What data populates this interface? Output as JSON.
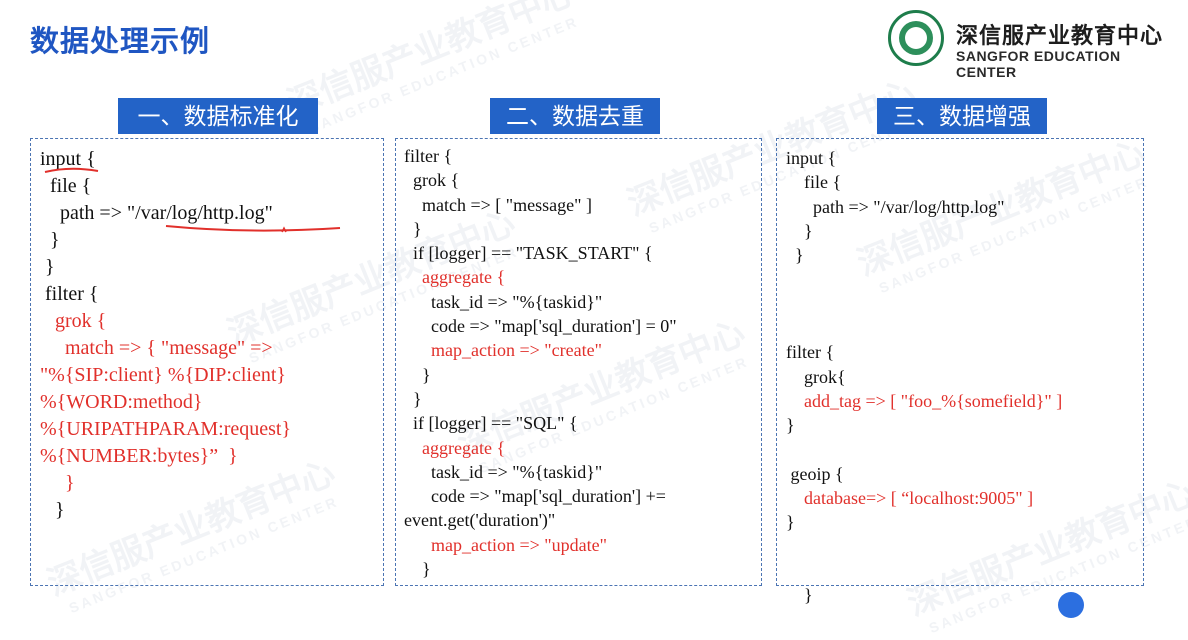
{
  "page": {
    "title": "数据处理示例"
  },
  "logo": {
    "name_cn": "深信服产业教育中心",
    "name_en": "SANGFOR EDUCATION CENTER"
  },
  "watermark": {
    "text_cn": "深信服产业教育中心",
    "text_en": "SANGFOR EDUCATION CENTER"
  },
  "sections": [
    {
      "label": "一、数据标准化",
      "lines": [
        {
          "text": "input {",
          "color": "black"
        },
        {
          "text": "  file {",
          "color": "black"
        },
        {
          "text": "    path => \"/var/log/http.log\"",
          "color": "black"
        },
        {
          "text": "  }",
          "color": "black"
        },
        {
          "text": " }",
          "color": "black"
        },
        {
          "text": " filter {",
          "color": "black"
        },
        {
          "text": "   grok {",
          "color": "red"
        },
        {
          "text": "     match => { \"message\" =>",
          "color": "red"
        },
        {
          "text": "\"%{SIP:client} %{DIP:client}",
          "color": "red"
        },
        {
          "text": "%{WORD:method}",
          "color": "red"
        },
        {
          "text": "%{URIPATHPARAM:request}",
          "color": "red"
        },
        {
          "text": "%{NUMBER:bytes}”  }",
          "color": "red"
        },
        {
          "text": "     }",
          "color": "red"
        },
        {
          "text": "   }",
          "color": "black"
        }
      ]
    },
    {
      "label": "二、数据去重",
      "lines": [
        {
          "text": "filter {",
          "color": "black"
        },
        {
          "text": "  grok {",
          "color": "black"
        },
        {
          "text": "    match => [ \"message\" ]",
          "color": "black"
        },
        {
          "text": "  }",
          "color": "black"
        },
        {
          "text": "  if [logger] == \"TASK_START\" {",
          "color": "black"
        },
        {
          "text": "    aggregate {",
          "color": "red"
        },
        {
          "text": "      task_id => \"%{taskid}\"",
          "color": "black"
        },
        {
          "text": "      code => \"map['sql_duration'] = 0\"",
          "color": "black"
        },
        {
          "text": "      map_action => \"create\"",
          "color": "red"
        },
        {
          "text": "    }",
          "color": "black"
        },
        {
          "text": "  }",
          "color": "black"
        },
        {
          "text": "  if [logger] == \"SQL\" {",
          "color": "black"
        },
        {
          "text": "    aggregate {",
          "color": "red"
        },
        {
          "text": "      task_id => \"%{taskid}\"",
          "color": "black"
        },
        {
          "text": "      code => \"map['sql_duration'] +=",
          "color": "black"
        },
        {
          "text": "event.get('duration')\"",
          "color": "black"
        },
        {
          "text": "      map_action => \"update\"",
          "color": "red"
        },
        {
          "text": "    }",
          "color": "black"
        }
      ]
    },
    {
      "label": "三、数据增强",
      "lines": [
        {
          "text": "input {",
          "color": "black"
        },
        {
          "text": "    file {",
          "color": "black"
        },
        {
          "text": "      path => \"/var/log/http.log\"",
          "color": "black"
        },
        {
          "text": "    }",
          "color": "black"
        },
        {
          "text": "  }",
          "color": "black"
        },
        {
          "text": "",
          "color": "black"
        },
        {
          "text": "",
          "color": "black"
        },
        {
          "text": "",
          "color": "black"
        },
        {
          "text": "filter {",
          "color": "black"
        },
        {
          "text": "    grok{",
          "color": "black"
        },
        {
          "text": "    add_tag => [ \"foo_%{somefield}\" ]",
          "color": "red"
        },
        {
          "text": "}",
          "color": "black"
        },
        {
          "text": "",
          "color": "black"
        },
        {
          "text": " geoip {",
          "color": "black"
        },
        {
          "text": "    database=> [ “localhost:9005\" ]",
          "color": "red"
        },
        {
          "text": "}",
          "color": "black"
        },
        {
          "text": "",
          "color": "black"
        },
        {
          "text": "",
          "color": "black"
        },
        {
          "text": "    }",
          "color": "black"
        }
      ]
    }
  ],
  "colors": {
    "title": "#1f56c2",
    "label_bg": "#2363c7",
    "code_red": "#e1302b",
    "box_border": "#4b74b3",
    "logo_green": "#1e7d4b"
  }
}
